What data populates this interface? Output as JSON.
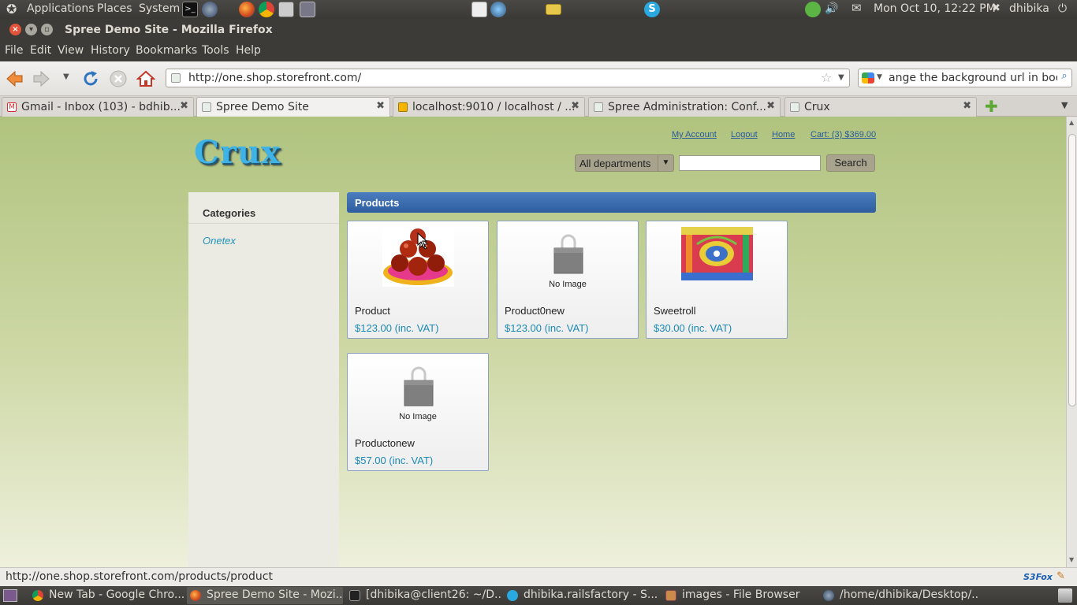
{
  "top_panel": {
    "applications": "Applications",
    "places": "Places",
    "system": "System",
    "datetime": "Mon Oct 10, 12:22 PM",
    "user": "dhibika"
  },
  "window": {
    "title": "Spree Demo Site - Mozilla Firefox"
  },
  "menubar": [
    "File",
    "Edit",
    "View",
    "History",
    "Bookmarks",
    "Tools",
    "Help"
  ],
  "navbar": {
    "url": "http://one.shop.storefront.com/",
    "search_value": "ange the background url in body"
  },
  "tabs": [
    {
      "label": "Gmail - Inbox (103) - bdhib...",
      "active": false
    },
    {
      "label": "Spree Demo Site",
      "active": true
    },
    {
      "label": "localhost:9010 / localhost / ...",
      "active": false
    },
    {
      "label": "Spree Administration: Conf...",
      "active": false
    },
    {
      "label": "Crux",
      "active": false
    }
  ],
  "site": {
    "logo": "Crux",
    "links": {
      "my_account": "My Account",
      "logout": "Logout",
      "home": "Home",
      "cart": "Cart: (3) $369.00"
    },
    "department_select": "All departments",
    "search_button": "Search",
    "sidebar": {
      "title": "Categories",
      "items": [
        "Onetex"
      ]
    },
    "products_header": "Products",
    "no_image_label": "No Image",
    "products": [
      {
        "name": "Product",
        "price": "$123.00 (inc. VAT)",
        "image": "photo-sweets"
      },
      {
        "name": "Product0new",
        "price": "$123.00 (inc. VAT)",
        "image": "no-image"
      },
      {
        "name": "Sweetroll",
        "price": "$30.00 (inc. VAT)",
        "image": "photo-textile"
      },
      {
        "name": "Productonew",
        "price": "$57.00 (inc. VAT)",
        "image": "no-image"
      }
    ]
  },
  "statusbar": {
    "text": "http://one.shop.storefront.com/products/product",
    "addon": "S3Fox"
  },
  "taskbar": [
    {
      "label": "New Tab - Google Chro...",
      "active": false
    },
    {
      "label": "Spree Demo Site - Mozi...",
      "active": true
    },
    {
      "label": "[dhibika@client26: ~/D...",
      "active": false
    },
    {
      "label": "dhibika.railsfactory - S...",
      "active": false
    },
    {
      "label": "images - File Browser",
      "active": false
    },
    {
      "label": "/home/dhibika/Desktop/...",
      "active": false
    }
  ],
  "colors": {
    "panel": "#3c3b37",
    "page_green": "#b0c37e",
    "products_header": "#3a6bb0",
    "price": "#1a8ab5",
    "logo": "#3fb3e6"
  }
}
